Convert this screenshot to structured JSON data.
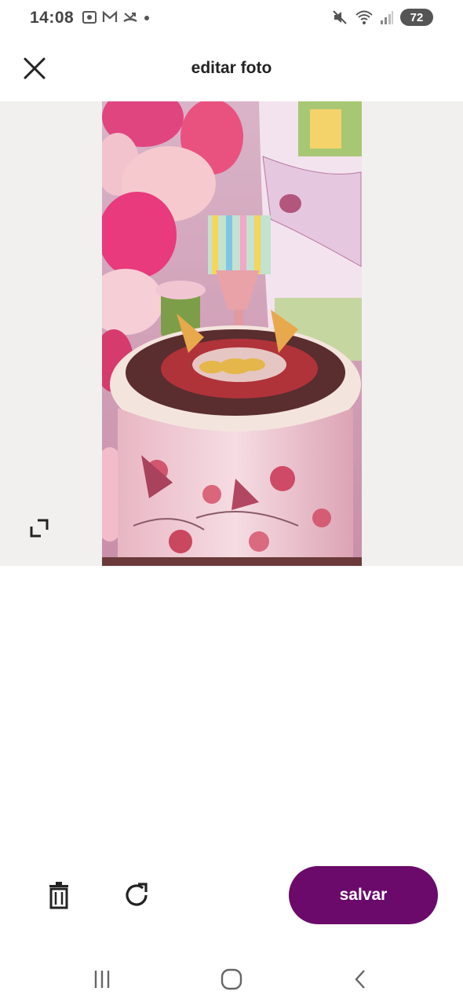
{
  "status_bar": {
    "time": "14:08",
    "left_icons": [
      "screenshot-icon",
      "gmail-icon",
      "missed-call-icon",
      "dot-icon"
    ],
    "right_icons": [
      "mute-icon",
      "wifi-icon",
      "signal-icon"
    ],
    "battery": "72"
  },
  "header": {
    "title": "editar foto",
    "close_icon": "close-icon"
  },
  "photo": {
    "description_icon": "photo"
  },
  "toolbar": {
    "delete_icon": "trash-icon",
    "rotate_icon": "rotate-icon",
    "expand_icon": "expand-icon",
    "save_label": "salvar"
  },
  "colors": {
    "accent": "#6b0a6b",
    "photo_bg": "#f1f0ee"
  },
  "nav_bar": {
    "icons": [
      "recents-icon",
      "home-icon",
      "back-icon"
    ]
  }
}
